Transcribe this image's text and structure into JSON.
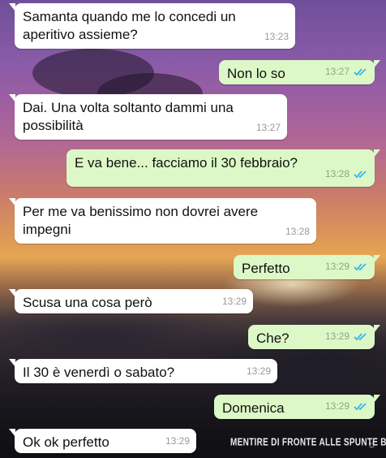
{
  "chat": {
    "messages": [
      {
        "text": "Samanta quando me lo concedi un aperitivo assieme?",
        "time": "13:23",
        "direction": "incoming"
      },
      {
        "text": "Non lo so",
        "time": "13:27",
        "direction": "outgoing",
        "status": "read"
      },
      {
        "text": "Dai. Una volta soltanto dammi una possibilità",
        "time": "13:27",
        "direction": "incoming"
      },
      {
        "text": "E va bene... facciamo il 30 febbraio?",
        "time": "13:28",
        "direction": "outgoing",
        "status": "read"
      },
      {
        "text": "Per me va benissimo non dovrei avere impegni",
        "time": "13:28",
        "direction": "incoming"
      },
      {
        "text": "Perfetto",
        "time": "13:29",
        "direction": "outgoing",
        "status": "read"
      },
      {
        "text": "Scusa una cosa però",
        "time": "13:29",
        "direction": "incoming"
      },
      {
        "text": "Che?",
        "time": "13:29",
        "direction": "outgoing",
        "status": "read"
      },
      {
        "text": "Il 30 è venerdì o sabato?",
        "time": "13:29",
        "direction": "incoming"
      },
      {
        "text": "Domenica",
        "time": "13:29",
        "direction": "outgoing",
        "status": "read"
      },
      {
        "text": "Ok ok perfetto",
        "time": "13:29",
        "direction": "incoming"
      }
    ]
  },
  "watermark": {
    "text": "MENTIRE DI FRONTE ALLE SPUNTE BLU",
    "logo": "☼"
  },
  "colors": {
    "incoming_bubble": "#ffffff",
    "outgoing_bubble": "#dcf8c6",
    "read_ticks": "#34b7f1",
    "timestamp": "#9a9a9a"
  },
  "icons": {
    "read_receipt": "double-check-icon",
    "watermark_logo": "sun-logo-icon"
  }
}
